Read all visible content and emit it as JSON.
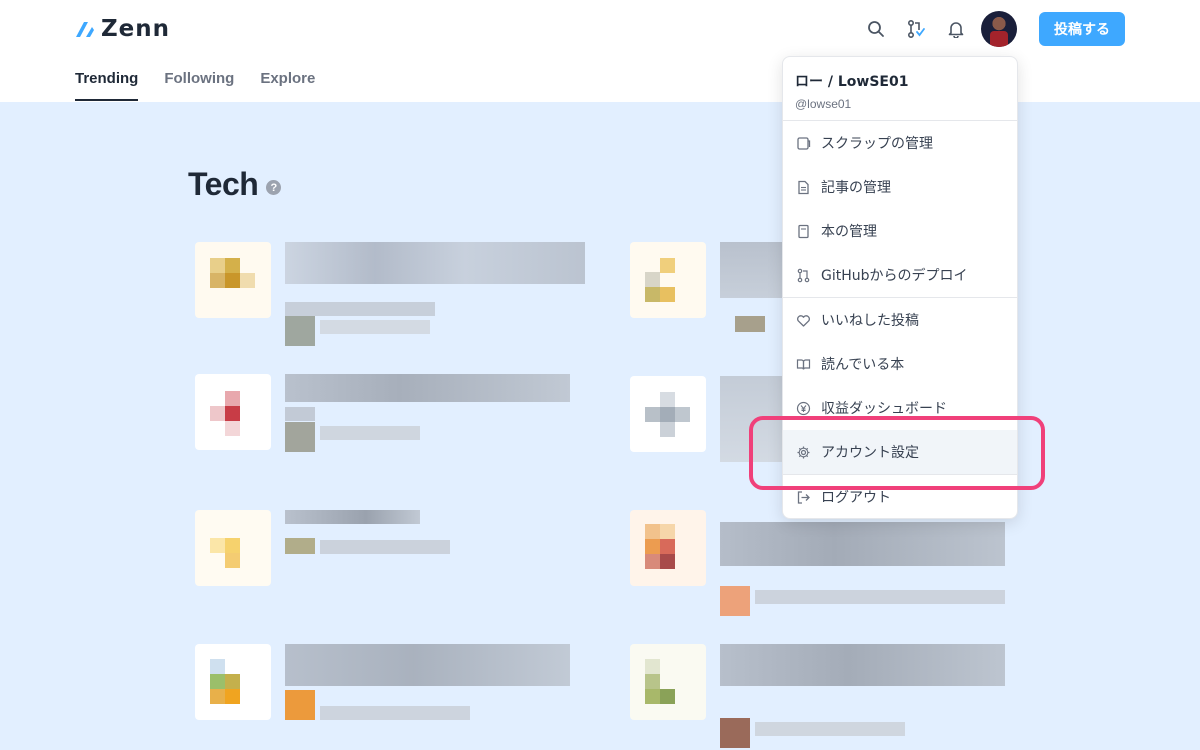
{
  "header": {
    "logo_text": "Zenn",
    "tabs": [
      {
        "label": "Trending",
        "active": true
      },
      {
        "label": "Following",
        "active": false
      },
      {
        "label": "Explore",
        "active": false
      }
    ],
    "icons": [
      "search-icon",
      "git-pull-request-icon",
      "bell-icon"
    ],
    "post_button_label": "投稿する",
    "accent_color": "#3ea8ff"
  },
  "main": {
    "section_title": "Tech",
    "help_icon_glyph": "?",
    "background_color": "#e2efff"
  },
  "menu": {
    "user_name": "ロー / LowSE01",
    "user_handle": "@lowse01",
    "groups": [
      [
        {
          "label": "スクラップの管理",
          "icon": "scrap-icon"
        },
        {
          "label": "記事の管理",
          "icon": "document-icon"
        },
        {
          "label": "本の管理",
          "icon": "book-icon"
        },
        {
          "label": "GitHubからのデプロイ",
          "icon": "git-icon"
        }
      ],
      [
        {
          "label": "いいねした投稿",
          "icon": "heart-icon"
        },
        {
          "label": "読んでいる本",
          "icon": "open-book-icon"
        },
        {
          "label": "収益ダッシュボード",
          "icon": "yen-icon"
        },
        {
          "label": "アカウント設定",
          "icon": "gear-icon"
        }
      ],
      [
        {
          "label": "ログアウト",
          "icon": "logout-icon"
        }
      ]
    ],
    "highlight_color": "#f0407a"
  }
}
